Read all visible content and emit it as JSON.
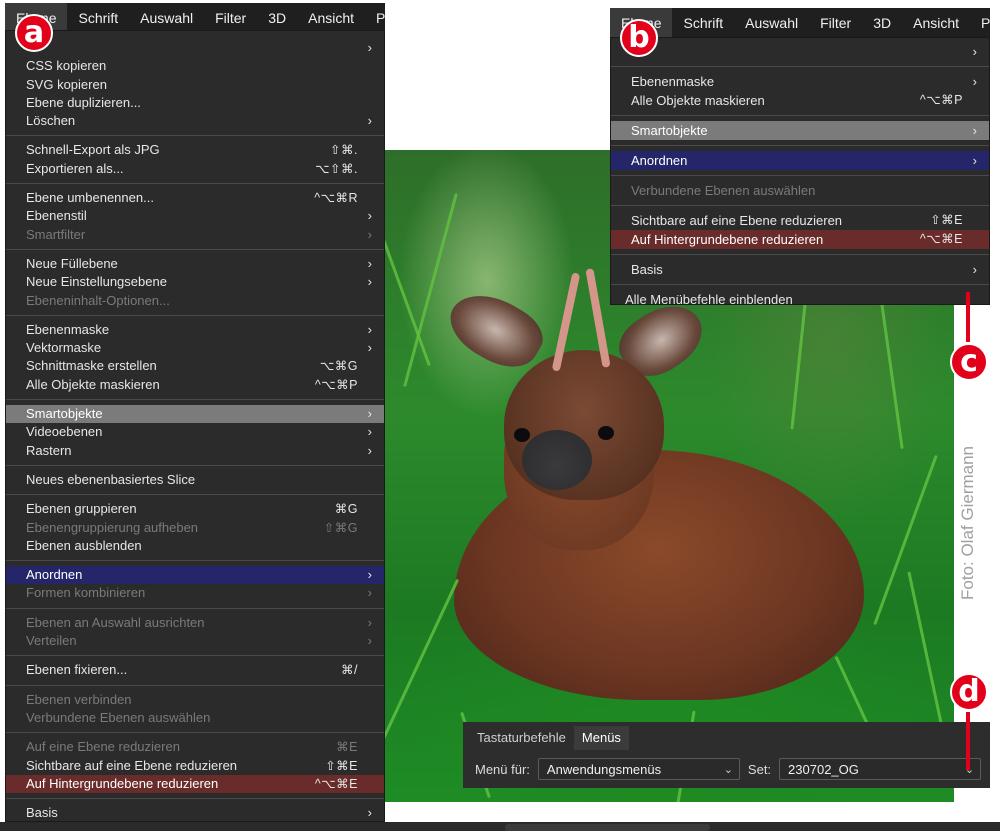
{
  "menubar_a": {
    "items": [
      "Ebene",
      "Schrift",
      "Auswahl",
      "Filter",
      "3D",
      "Ansicht",
      "Plu"
    ]
  },
  "menubar_b": {
    "items": [
      "Ebene",
      "Schrift",
      "Auswahl",
      "Filter",
      "3D",
      "Ansicht",
      "Plu"
    ]
  },
  "menu_a": {
    "top_arrow": "›",
    "groups": [
      [
        {
          "label": "CSS kopieren",
          "shortcut": "",
          "arrow": false,
          "disabled": false
        },
        {
          "label": "SVG kopieren",
          "shortcut": "",
          "arrow": false,
          "disabled": false
        },
        {
          "label": "Ebene duplizieren...",
          "shortcut": "",
          "arrow": false,
          "disabled": false
        },
        {
          "label": "Löschen",
          "shortcut": "",
          "arrow": true,
          "disabled": false
        }
      ],
      [
        {
          "label": "Schnell-Export als JPG",
          "shortcut": "⇧⌘.",
          "arrow": false,
          "disabled": false
        },
        {
          "label": "Exportieren als...",
          "shortcut": "⌥⇧⌘.",
          "arrow": false,
          "disabled": false
        }
      ],
      [
        {
          "label": "Ebene umbenennen...",
          "shortcut": "^⌥⌘R",
          "arrow": false,
          "disabled": false
        },
        {
          "label": "Ebenenstil",
          "shortcut": "",
          "arrow": true,
          "disabled": false
        },
        {
          "label": "Smartfilter",
          "shortcut": "",
          "arrow": true,
          "disabled": true
        }
      ],
      [
        {
          "label": "Neue Füllebene",
          "shortcut": "",
          "arrow": true,
          "disabled": false
        },
        {
          "label": "Neue Einstellungsebene",
          "shortcut": "",
          "arrow": true,
          "disabled": false
        },
        {
          "label": "Ebeneninhalt-Optionen...",
          "shortcut": "",
          "arrow": false,
          "disabled": true
        }
      ],
      [
        {
          "label": "Ebenenmaske",
          "shortcut": "",
          "arrow": true,
          "disabled": false
        },
        {
          "label": "Vektormaske",
          "shortcut": "",
          "arrow": true,
          "disabled": false
        },
        {
          "label": "Schnittmaske erstellen",
          "shortcut": "⌥⌘G",
          "arrow": false,
          "disabled": false
        },
        {
          "label": "Alle Objekte maskieren",
          "shortcut": "^⌥⌘P",
          "arrow": false,
          "disabled": false
        }
      ],
      [
        {
          "label": "Smartobjekte",
          "shortcut": "",
          "arrow": true,
          "disabled": false,
          "highlight": "gray"
        },
        {
          "label": "Videoebenen",
          "shortcut": "",
          "arrow": true,
          "disabled": false
        },
        {
          "label": "Rastern",
          "shortcut": "",
          "arrow": true,
          "disabled": false
        }
      ],
      [
        {
          "label": "Neues ebenenbasiertes Slice",
          "shortcut": "",
          "arrow": false,
          "disabled": false
        }
      ],
      [
        {
          "label": "Ebenen gruppieren",
          "shortcut": "⌘G",
          "arrow": false,
          "disabled": false
        },
        {
          "label": "Ebenengruppierung aufheben",
          "shortcut": "⇧⌘G",
          "arrow": false,
          "disabled": true
        },
        {
          "label": "Ebenen ausblenden",
          "shortcut": "",
          "arrow": false,
          "disabled": false
        }
      ],
      [
        {
          "label": "Anordnen",
          "shortcut": "",
          "arrow": true,
          "disabled": false,
          "highlight": "blue"
        },
        {
          "label": "Formen kombinieren",
          "shortcut": "",
          "arrow": true,
          "disabled": true
        }
      ],
      [
        {
          "label": "Ebenen an Auswahl ausrichten",
          "shortcut": "",
          "arrow": true,
          "disabled": true
        },
        {
          "label": "Verteilen",
          "shortcut": "",
          "arrow": true,
          "disabled": true
        }
      ],
      [
        {
          "label": "Ebenen fixieren...",
          "shortcut": "⌘/",
          "arrow": false,
          "disabled": false
        }
      ],
      [
        {
          "label": "Ebenen verbinden",
          "shortcut": "",
          "arrow": false,
          "disabled": true
        },
        {
          "label": "Verbundene Ebenen auswählen",
          "shortcut": "",
          "arrow": false,
          "disabled": true
        }
      ],
      [
        {
          "label": "Auf eine Ebene reduzieren",
          "shortcut": "⌘E",
          "arrow": false,
          "disabled": true
        },
        {
          "label": "Sichtbare auf eine Ebene reduzieren",
          "shortcut": "⇧⌘E",
          "arrow": false,
          "disabled": false
        },
        {
          "label": "Auf Hintergrundebene reduzieren",
          "shortcut": "^⌥⌘E",
          "arrow": false,
          "disabled": false,
          "highlight": "red"
        }
      ],
      [
        {
          "label": "Basis",
          "shortcut": "",
          "arrow": true,
          "disabled": false
        }
      ]
    ]
  },
  "menu_b": {
    "top_arrow": "›",
    "groups": [
      [
        {
          "label": "Ebenenmaske",
          "shortcut": "",
          "arrow": true,
          "disabled": false
        },
        {
          "label": "Alle Objekte maskieren",
          "shortcut": "^⌥⌘P",
          "arrow": false,
          "disabled": false
        }
      ],
      [
        {
          "label": "Smartobjekte",
          "shortcut": "",
          "arrow": true,
          "disabled": false,
          "highlight": "gray"
        }
      ],
      [
        {
          "label": "Anordnen",
          "shortcut": "",
          "arrow": true,
          "disabled": false,
          "highlight": "blue"
        }
      ],
      [
        {
          "label": "Verbundene Ebenen auswählen",
          "shortcut": "",
          "arrow": false,
          "disabled": true
        }
      ],
      [
        {
          "label": "Sichtbare auf eine Ebene reduzieren",
          "shortcut": "⇧⌘E",
          "arrow": false,
          "disabled": false
        },
        {
          "label": "Auf Hintergrundebene reduzieren",
          "shortcut": "^⌥⌘E",
          "arrow": false,
          "disabled": false,
          "highlight": "red"
        }
      ],
      [
        {
          "label": "Basis",
          "shortcut": "",
          "arrow": true,
          "disabled": false
        }
      ]
    ],
    "footer": "Alle Menübefehle einblenden"
  },
  "panel_d": {
    "tabs": [
      "Tastaturbefehle",
      "Menüs"
    ],
    "active_tab": "Menüs",
    "menu_for_label": "Menü für:",
    "menu_for_value": "Anwendungsmenüs",
    "set_label": "Set:",
    "set_value": "230702_OG"
  },
  "badges": {
    "a": "a",
    "b": "b",
    "c": "c",
    "d": "d"
  },
  "photo_credit": "Foto: Olaf Giermann",
  "colors": {
    "badge": "#e2001a",
    "highlight_blue": "#25256a",
    "highlight_red": "#6a2b2b",
    "highlight_gray": "#7b7b7b"
  }
}
